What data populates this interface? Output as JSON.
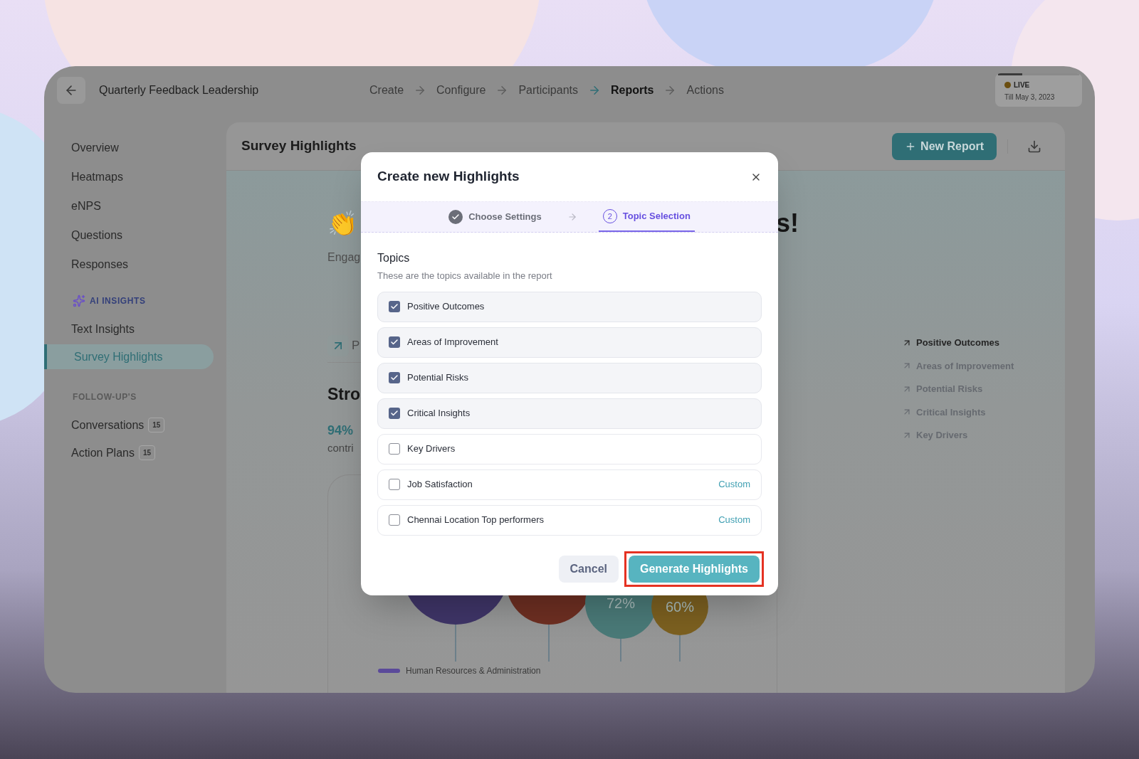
{
  "header": {
    "title": "Quarterly Feedback Leadership",
    "steps": [
      {
        "label": "Create",
        "selected": false
      },
      {
        "label": "Configure",
        "selected": false
      },
      {
        "label": "Participants",
        "selected": false
      },
      {
        "label": "Reports",
        "selected": true
      },
      {
        "label": "Actions",
        "selected": false
      }
    ],
    "status": {
      "label": "LIVE",
      "date": "Till May 3, 2023",
      "level": 0.3
    }
  },
  "sidebar": {
    "items": [
      {
        "label": "Overview",
        "selected": false
      },
      {
        "label": "Heatmaps",
        "selected": false
      },
      {
        "label": "eNPS",
        "selected": false
      },
      {
        "label": "Questions",
        "selected": false
      },
      {
        "label": "Responses",
        "selected": false
      }
    ],
    "sections": [
      {
        "title": "AI INSIGHTS",
        "kind": "ai",
        "items": [
          {
            "label": "Text Insights",
            "selected": false
          },
          {
            "label": "Survey Highlights",
            "selected": true
          }
        ]
      },
      {
        "title": "FOLLOW-UP'S",
        "kind": "plain",
        "items": [
          {
            "label": "Conversations",
            "count": "15",
            "selected": false
          },
          {
            "label": "Action Plans",
            "count": "15",
            "selected": false
          }
        ]
      }
    ]
  },
  "main": {
    "title": "Survey Highlights",
    "new_report": "New Report",
    "emoji": "👏",
    "heading_fragment": "s!",
    "subtitle_fragment": "Engag",
    "tab_fragment": "P",
    "section_fragment": "Stro",
    "stat": "94%",
    "stat_caption_fragment": "contri",
    "bubbles": [
      {
        "color": "#3f3568"
      },
      {
        "color": "#6e2f22"
      },
      {
        "label": "72%",
        "color": "#4a7a78"
      },
      {
        "label": "60%",
        "color": "#7c6020"
      }
    ],
    "legend": [
      {
        "label": "Human Resources & Administration",
        "color": "#5b4a9a"
      }
    ],
    "topics": [
      {
        "label": "Positive Outcomes",
        "selected": true
      },
      {
        "label": "Areas of Improvement",
        "selected": false
      },
      {
        "label": "Potential Risks",
        "selected": false
      },
      {
        "label": "Critical Insights",
        "selected": false
      },
      {
        "label": "Key Drivers",
        "selected": false
      }
    ]
  },
  "dialog": {
    "title": "Create new Highlights",
    "steps": [
      {
        "label": "Choose Settings",
        "done": true,
        "selected": false
      },
      {
        "number": "2",
        "label": "Topic Selection",
        "done": false,
        "selected": true
      }
    ],
    "section_title": "Topics",
    "section_hint": "These are the topics available in the report",
    "topics": [
      {
        "label": "Positive Outcomes",
        "checked": true
      },
      {
        "label": "Areas of Improvement",
        "checked": true
      },
      {
        "label": "Potential Risks",
        "checked": true
      },
      {
        "label": "Critical Insights",
        "checked": true
      },
      {
        "label": "Key Drivers",
        "checked": false
      },
      {
        "label": "Job Satisfaction",
        "checked": false,
        "tag": "Custom"
      },
      {
        "label": "Chennai Location Top performers",
        "checked": false,
        "tag": "Custom"
      }
    ],
    "cancel": "Cancel",
    "confirm": {
      "label": "Generate Highlights",
      "highlighted": true
    }
  }
}
